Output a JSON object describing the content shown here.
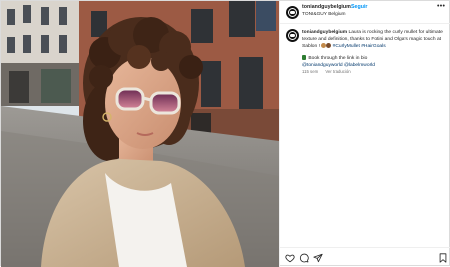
{
  "post": {
    "username": "toniandguybelgium",
    "separator": "•",
    "follow_label": "Seguir",
    "location": "TONI&GUY Belgium",
    "more_label": "•••"
  },
  "caption": {
    "username": "toniandguybelgium",
    "text": "Laura is rocking the curly mullet for ultimate texture and definition, thanks to Fotini and Olga's magic touch at Sablon !",
    "hashtags": "#CurlyMullet #HairGoals",
    "book_line": "Book through the link in bio",
    "mentions": "@toniandguyworld @labelmworld",
    "time": "115 sem",
    "translation_label": "Ver tradución"
  },
  "icons": {
    "like": "heart-icon",
    "comment": "comment-icon",
    "share": "share-icon",
    "save": "bookmark-icon",
    "more": "more-options-icon",
    "book": "book-icon"
  },
  "colors": {
    "link_blue": "#0095f6",
    "hashtag": "#00376b",
    "muted": "#737373",
    "text": "#262626"
  }
}
